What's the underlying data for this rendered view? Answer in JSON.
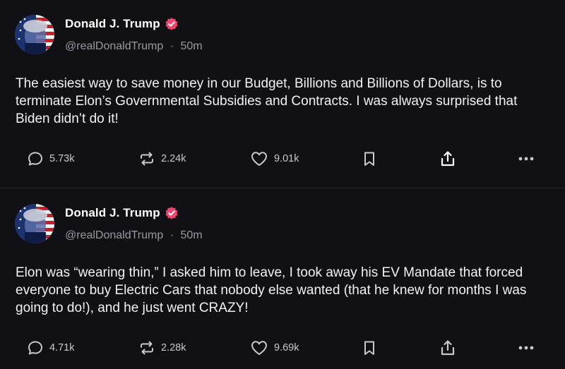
{
  "posts": [
    {
      "author_name": "Donald J. Trump",
      "handle": "@realDonaldTrump",
      "separator": "·",
      "time": "50m",
      "text": "The easiest way to save money in our Budget, Billions and Billions of Dollars, is to terminate Elon’s Governmental Subsidies and Contracts. I was always surprised that Biden didn’t do it!",
      "replies": "5.73k",
      "reposts": "2.24k",
      "likes": "9.01k"
    },
    {
      "author_name": "Donald J. Trump",
      "handle": "@realDonaldTrump",
      "separator": "·",
      "time": "50m",
      "text": "Elon was “wearing thin,” I asked him to leave, I took away his EV Mandate that forced everyone to buy Electric Cars that nobody else wanted (that he knew for months I was going to do!), and he just went CRAZY!",
      "replies": "4.71k",
      "reposts": "2.28k",
      "likes": "9.69k"
    }
  ],
  "icons": {
    "verified_badge": "verified-badge-icon",
    "reply": "reply-icon",
    "repost": "repost-icon",
    "like": "heart-icon",
    "bookmark": "bookmark-icon",
    "share": "share-icon",
    "more": "more-icon"
  },
  "colors": {
    "background": "#111014",
    "divider": "#2c2a32",
    "verified_badge": "#f2456e",
    "secondary_text": "#9a98a3",
    "action_icon": "#c9c7d0"
  }
}
